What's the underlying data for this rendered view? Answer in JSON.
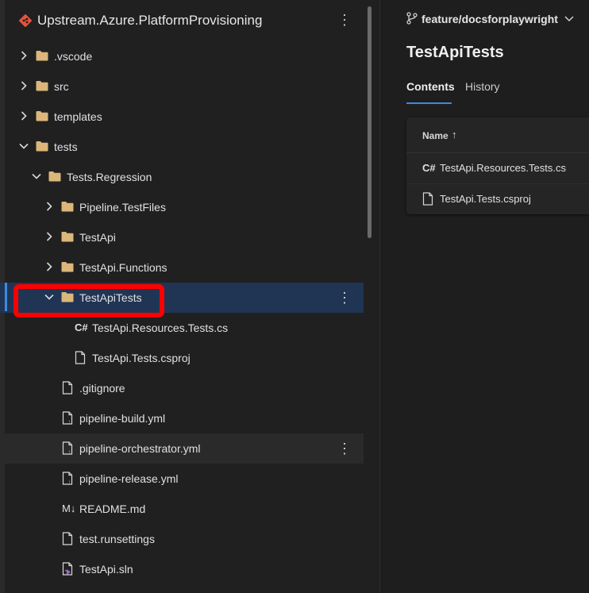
{
  "repo": {
    "title": "Upstream.Azure.PlatformProvisioning",
    "more_label": "⋮"
  },
  "tree": [
    {
      "label": ".vscode",
      "type": "folder",
      "expanded": false
    },
    {
      "label": "src",
      "type": "folder",
      "expanded": false
    },
    {
      "label": "templates",
      "type": "folder",
      "expanded": false
    },
    {
      "label": "tests",
      "type": "folder",
      "expanded": true
    },
    {
      "label": "Tests.Regression",
      "type": "folder",
      "expanded": true
    },
    {
      "label": "Pipeline.TestFiles",
      "type": "folder",
      "expanded": false
    },
    {
      "label": "TestApi",
      "type": "folder",
      "expanded": false
    },
    {
      "label": "TestApi.Functions",
      "type": "folder",
      "expanded": false
    },
    {
      "label": "TestApiTests",
      "type": "folder",
      "expanded": true,
      "selected": true
    },
    {
      "label": "TestApi.Resources.Tests.cs",
      "type": "csharp",
      "glyph": "C#"
    },
    {
      "label": "TestApi.Tests.csproj",
      "type": "file"
    },
    {
      "label": ".gitignore",
      "type": "file"
    },
    {
      "label": "pipeline-build.yml",
      "type": "yaml"
    },
    {
      "label": "pipeline-orchestrator.yml",
      "type": "yaml"
    },
    {
      "label": "pipeline-release.yml",
      "type": "yaml"
    },
    {
      "label": "README.md",
      "type": "markdown",
      "glyph": "M↓"
    },
    {
      "label": "test.runsettings",
      "type": "file"
    },
    {
      "label": "TestApi.sln",
      "type": "solution"
    }
  ],
  "kebab": "⋮",
  "branch": {
    "label": "feature/docsforplaywright",
    "chevron": "⌄"
  },
  "page": {
    "title": "TestApiTests"
  },
  "tabs": [
    {
      "label": "Contents",
      "active": true
    },
    {
      "label": "History",
      "active": false
    }
  ],
  "table": {
    "header": "Name",
    "sort_glyph": "↑",
    "rows": [
      {
        "label": "TestApi.Resources.Tests.cs",
        "glyph": "C#"
      },
      {
        "label": "TestApi.Tests.csproj"
      }
    ]
  },
  "colors": {
    "accent": "#3b8be0",
    "highlight": "#ff0000",
    "selected_row": "#203554",
    "folder": "#dcb67a",
    "repo_icon": "#e8533a"
  }
}
